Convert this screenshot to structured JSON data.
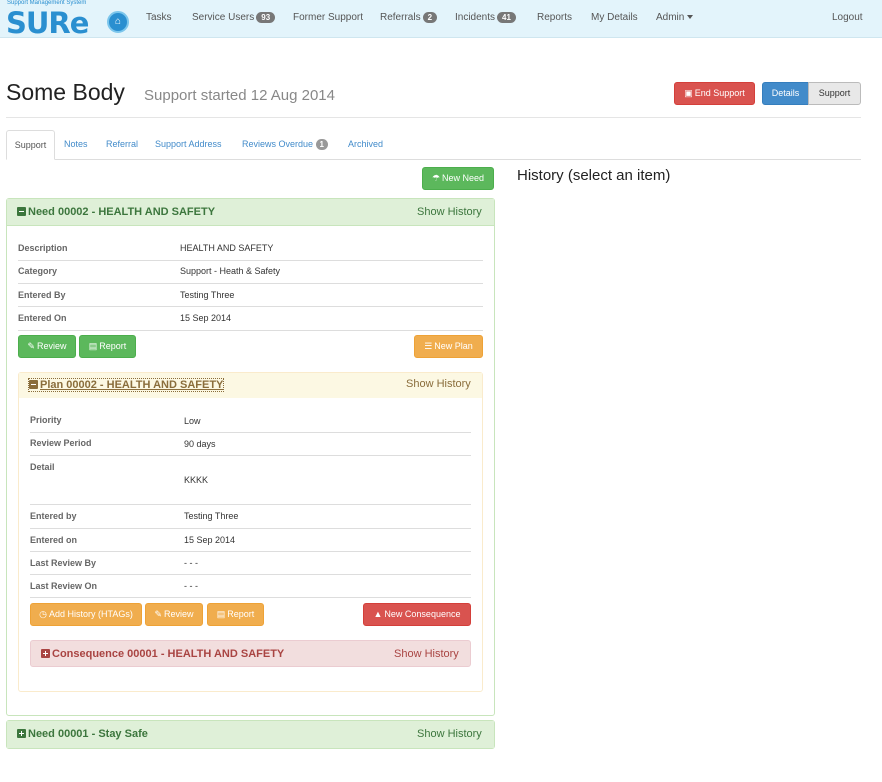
{
  "app": {
    "logo_tagline": "Support Management System",
    "logo_text": "SURe"
  },
  "nav": {
    "tasks": "Tasks",
    "service_users": "Service Users",
    "service_users_count": "93",
    "former_support": "Former Support",
    "referrals": "Referrals",
    "referrals_count": "2",
    "incidents": "Incidents",
    "incidents_count": "41",
    "reports": "Reports",
    "my_details": "My Details",
    "admin": "Admin",
    "logout": "Logout"
  },
  "header": {
    "name": "Some Body",
    "support_started": "Support started 12 Aug 2014",
    "end_support": "End Support",
    "details": "Details",
    "support": "Support"
  },
  "tabs": {
    "support": "Support",
    "notes": "Notes",
    "referral": "Referral",
    "support_address": "Support Address",
    "reviews_overdue": "Reviews Overdue",
    "reviews_overdue_count": "1",
    "archived": "Archived"
  },
  "history": {
    "title": "History (select an item)"
  },
  "new_need_button": "New Need",
  "need1": {
    "title": "Need 00002 - HEALTH AND SAFETY",
    "show_history": "Show History",
    "rows": [
      {
        "label": "Description",
        "value": "HEALTH AND SAFETY"
      },
      {
        "label": "Category",
        "value": "Support - Heath & Safety"
      },
      {
        "label": "Entered By",
        "value": "Testing Three"
      },
      {
        "label": "Entered On",
        "value": "15 Sep 2014"
      }
    ],
    "review": "Review",
    "report": "Report",
    "new_plan": "New Plan"
  },
  "plan": {
    "title": "Plan 00002 - HEALTH AND SAFETY",
    "show_history": "Show History",
    "rows": [
      {
        "label": "Priority",
        "value": "Low"
      },
      {
        "label": "Review Period",
        "value": "90 days"
      },
      {
        "label": "Detail",
        "value": "KKKK"
      },
      {
        "label": "Entered by",
        "value": "Testing Three"
      },
      {
        "label": "Entered on",
        "value": "15 Sep 2014"
      },
      {
        "label": "Last Review By",
        "value": "- - -"
      },
      {
        "label": "Last Review On",
        "value": "- - -"
      }
    ],
    "add_history": "Add History (HTAGs)",
    "review": "Review",
    "report": "Report",
    "new_consequence": "New Consequence"
  },
  "consequence": {
    "title": "Consequence 00001 - HEALTH AND SAFETY",
    "show_history": "Show History"
  },
  "need2": {
    "title": "Need 00001 - Stay Safe",
    "show_history": "Show History"
  }
}
